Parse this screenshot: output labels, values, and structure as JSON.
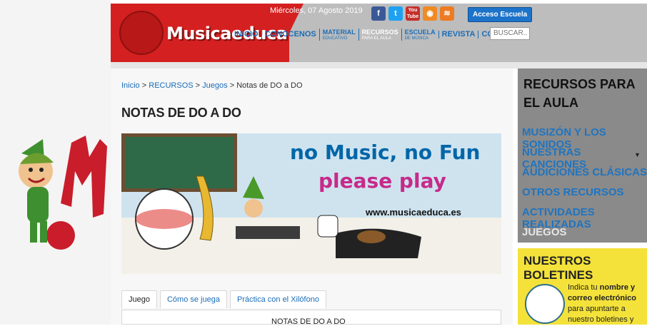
{
  "header": {
    "logo_text": "Musicaeduca",
    "date": "Miércoles, 07 Agosto 2019",
    "access_button": "Acceso Escuela",
    "search_placeholder": "BUSCAR...",
    "social_icons": [
      "facebook-icon",
      "twitter-icon",
      "youtube-icon",
      "ivoox-icon",
      "rss-icon"
    ],
    "social_colors": [
      "#3b5998",
      "#1da1f2",
      "#c4302b",
      "#f08a24",
      "#ee7b22"
    ],
    "social_glyphs": [
      "f",
      "t",
      "You\nTube",
      "◉",
      "≋"
    ]
  },
  "nav": {
    "items": [
      {
        "label": "INICIO",
        "sub": ""
      },
      {
        "label": "CONÓCENOS",
        "sub": ""
      },
      {
        "label": "MATERIAL",
        "sub": "EDUCATIVO"
      },
      {
        "label": "RECURSOS",
        "sub": "PARA EL AULA"
      },
      {
        "label": "ESCUELA",
        "sub": "DE MÚSICA"
      },
      {
        "label": "REVISTA",
        "sub": ""
      },
      {
        "label": "CONTACTO",
        "sub": ""
      }
    ]
  },
  "breadcrumb": {
    "home": "Inicio",
    "sep": ">",
    "section": "RECURSOS",
    "category": "Juegos",
    "current": "Notas de DO a DO"
  },
  "page": {
    "title": "NOTAS DE DO A DO"
  },
  "banner": {
    "slogan_line1": "no Music, no Fun",
    "slogan_line2": "please play",
    "url": "www.musicaeduca.es"
  },
  "tabs": {
    "items": [
      "Juego",
      "Cómo se juega",
      "Práctica con el Xilófono"
    ],
    "selected": 0,
    "panel_title": "NOTAS DE DO A DO"
  },
  "sidebar": {
    "title": "RECURSOS PARA EL AULA",
    "items": [
      "MUSIZÓN Y LOS SONIDOS",
      "NUESTRAS CANCIONES",
      "AUDICIONES CLÁSICAS",
      "OTROS RECURSOS",
      "ACTIVIDADES REALIZADAS",
      "JUEGOS"
    ],
    "active_item": "JUEGOS"
  },
  "boletin": {
    "title": "NUESTROS BOLETINES",
    "text_1": "Indica tu ",
    "text_bold_1": "nombre y correo electrónico",
    "text_2": " para apuntarte a nuestro boletines y"
  },
  "colors": {
    "brand_red": "#d42020",
    "link_blue": "#1a6db8",
    "sidebar_gray": "#8a8a8a",
    "boletin_yellow": "#f4e23a"
  }
}
